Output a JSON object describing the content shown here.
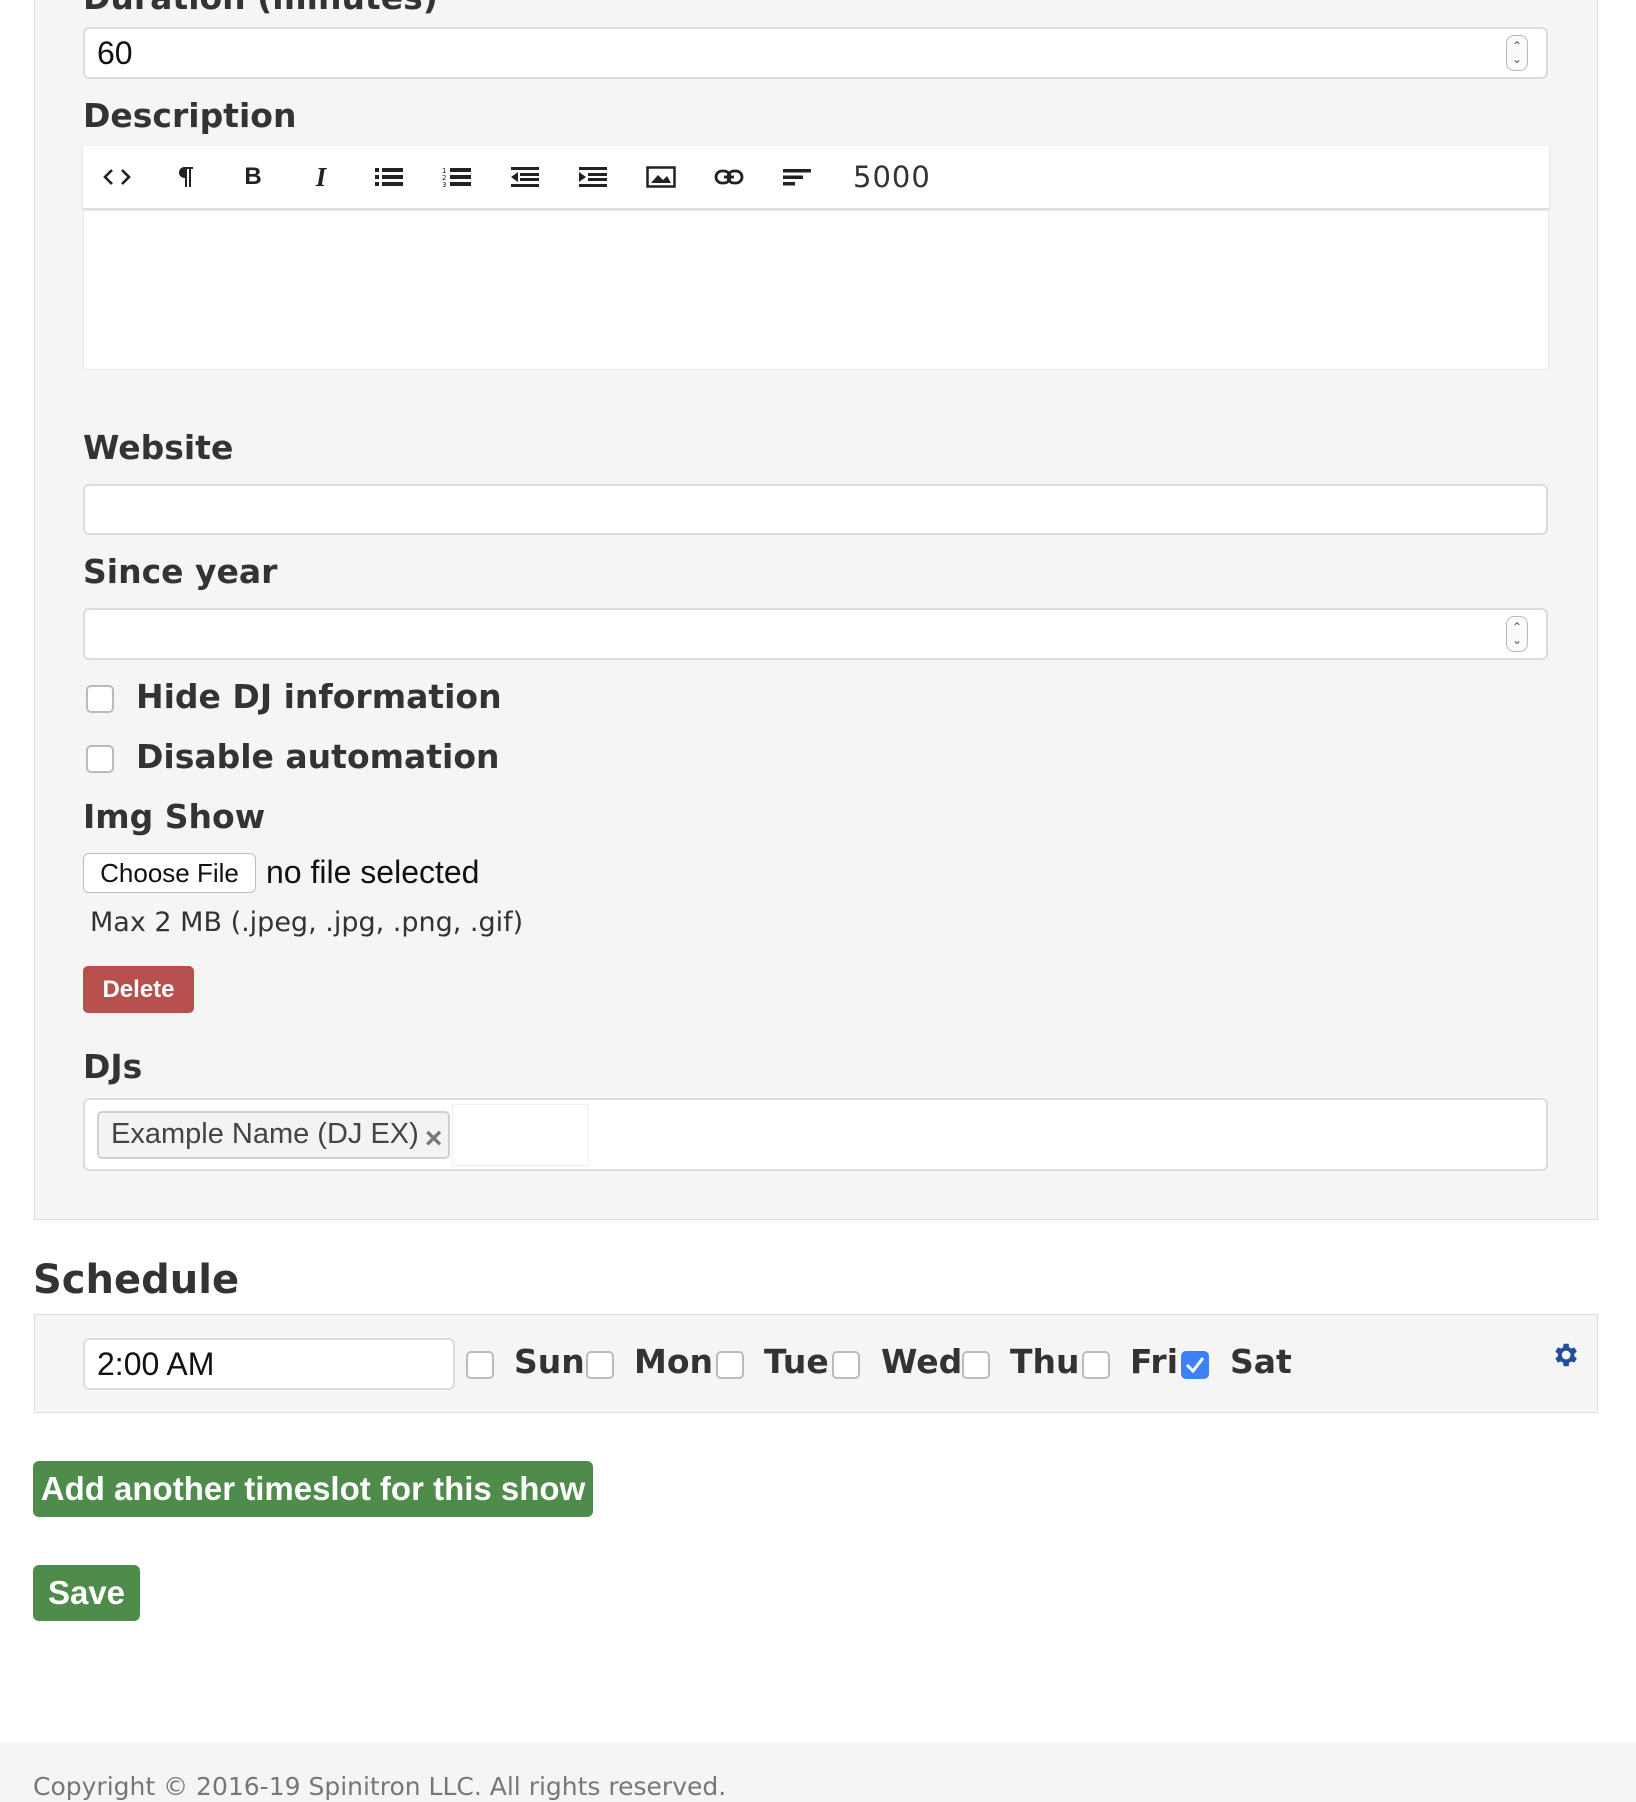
{
  "details": {
    "duration_label": "Duration (minutes)",
    "duration_value": "60",
    "description_label": "Description",
    "editor": {
      "tools": [
        "code-icon",
        "paragraph-icon",
        "bold-icon",
        "italic-icon",
        "bullet-list-icon",
        "numbered-list-icon",
        "outdent-icon",
        "indent-icon",
        "image-icon",
        "link-icon",
        "align-icon"
      ],
      "char_count": "5000"
    },
    "website_label": "Website",
    "website_value": "",
    "since_year_label": "Since year",
    "since_year_value": "",
    "hide_dj_label": "Hide DJ information",
    "hide_dj_checked": false,
    "disable_automation_label": "Disable automation",
    "disable_automation_checked": false,
    "img_show_label": "Img Show",
    "choose_file_label": "Choose File",
    "no_file_text": "no file selected",
    "file_hint": "Max 2 MB (.jpeg, .jpg, .png, .gif)",
    "delete_label": "Delete",
    "djs_label": "DJs",
    "dj_tags": [
      "Example Name (DJ EX)"
    ],
    "dj_tag_remove": "×"
  },
  "schedule": {
    "heading": "Schedule",
    "time_value": "2:00 AM",
    "days": [
      {
        "label": "Sun",
        "checked": false
      },
      {
        "label": "Mon",
        "checked": false
      },
      {
        "label": "Tue",
        "checked": false
      },
      {
        "label": "Wed",
        "checked": false
      },
      {
        "label": "Thu",
        "checked": false
      },
      {
        "label": "Fri",
        "checked": false
      },
      {
        "label": "Sat",
        "checked": true
      }
    ],
    "settings_icon": "gear-icon"
  },
  "actions": {
    "add_timeslot_label": "Add another timeslot for this show",
    "save_label": "Save"
  },
  "footer": {
    "copyright": "Copyright © 2016-19 Spinitron LLC. All rights reserved."
  },
  "colors": {
    "panel_bg": "#f5f5f5",
    "danger": "#b5504c",
    "success": "#4f8b4a",
    "checkbox_checked": "#3b82f6",
    "gear": "#1f4e9c"
  }
}
